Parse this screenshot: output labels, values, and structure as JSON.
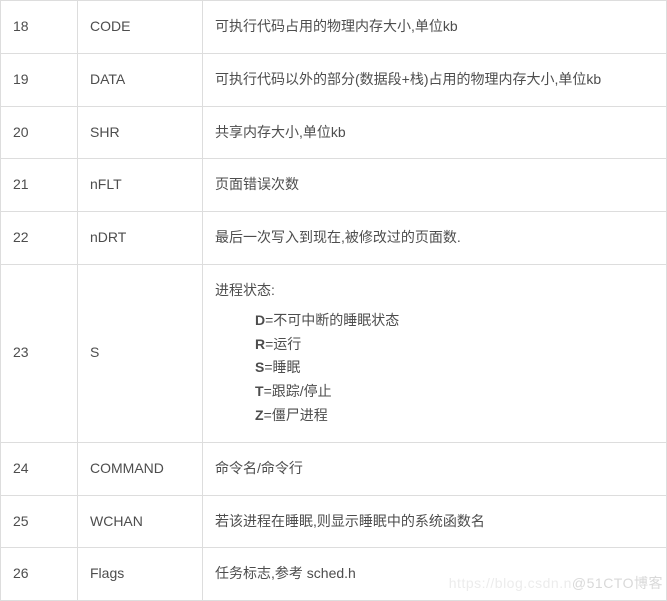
{
  "rows": [
    {
      "num": "18",
      "name": "CODE",
      "desc": "可执行代码占用的物理内存大小,单位kb"
    },
    {
      "num": "19",
      "name": "DATA",
      "desc": "可执行代码以外的部分(数据段+栈)占用的物理内存大小,单位kb"
    },
    {
      "num": "20",
      "name": "SHR",
      "desc": "共享内存大小,单位kb"
    },
    {
      "num": "21",
      "name": "nFLT",
      "desc": "页面错误次数"
    },
    {
      "num": "22",
      "name": "nDRT",
      "desc": "最后一次写入到现在,被修改过的页面数."
    },
    {
      "num": "23",
      "name": "S",
      "desc": "进程状态:",
      "status": [
        {
          "k": "D",
          "v": "=不可中断的睡眠状态"
        },
        {
          "k": "R",
          "v": "=运行"
        },
        {
          "k": "S",
          "v": "=睡眠"
        },
        {
          "k": "T",
          "v": "=跟踪/停止"
        },
        {
          "k": "Z",
          "v": "=僵尸进程"
        }
      ]
    },
    {
      "num": "24",
      "name": "COMMAND",
      "desc": "命令名/命令行"
    },
    {
      "num": "25",
      "name": "WCHAN",
      "desc": "若该进程在睡眠,则显示睡眠中的系统函数名"
    },
    {
      "num": "26",
      "name": "Flags",
      "desc": "任务标志,参考 sched.h"
    }
  ],
  "watermark": {
    "faint": "https://blog.csdn.n",
    "main": "@51CTO博客"
  }
}
